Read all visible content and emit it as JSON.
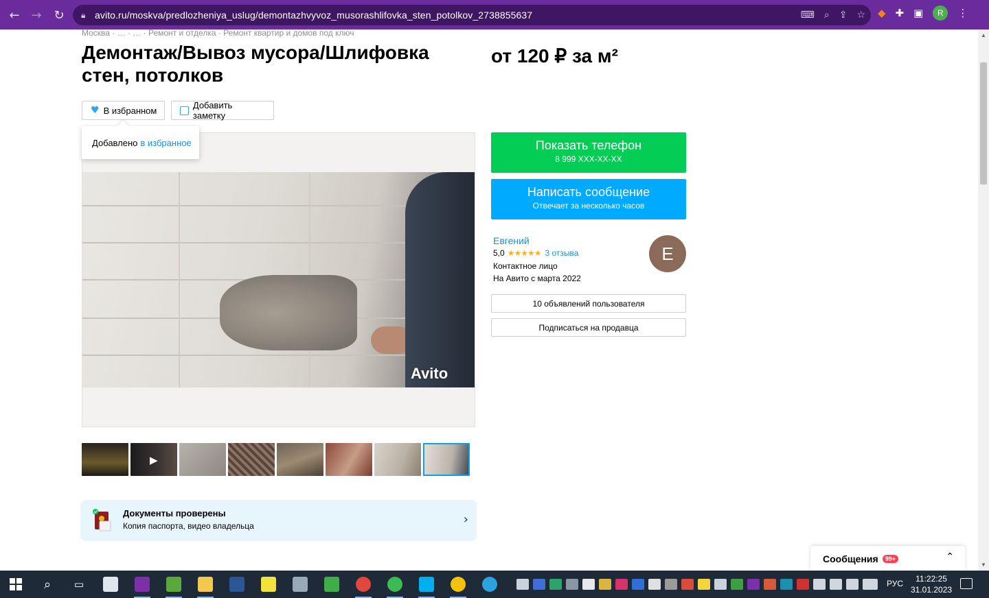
{
  "browser": {
    "url": "avito.ru/moskva/predlozheniya_uslug/demontazhvyvoz_musorashlifovka_sten_potolkov_2738855637",
    "profile_initial": "R"
  },
  "breadcrumbs": "Москва · … · … · Ремонт и отделка · Ремонт квартир и домов под ключ",
  "listing": {
    "title": "Демонтаж/Вывоз мусора/Шлифовка стен, потолков",
    "price": "от 120 ₽ за м²",
    "favorite_label": "В избранном",
    "note_label": "Добавить заметку",
    "tooltip_text": "Добавлено",
    "tooltip_link": "в избранное",
    "watermark": "Avito"
  },
  "contact": {
    "phone_label": "Показать телефон",
    "phone_masked": "8 999 XXX-XX-XX",
    "message_label": "Написать сообщение",
    "message_sub": "Отвечает за несколько часов"
  },
  "seller": {
    "name": "Евгений",
    "rating": "5,0",
    "stars": "★★★★★",
    "reviews": "3 отзыва",
    "role": "Контактное лицо",
    "since": "На Авито с марта 2022",
    "avatar_letter": "Е",
    "listings_button": "10 объявлений пользователя",
    "subscribe_button": "Подписаться на продавца"
  },
  "docs": {
    "title": "Документы проверены",
    "subtitle": "Копия паспорта, видео владельца"
  },
  "messages": {
    "label": "Сообщения",
    "badge": "99+"
  },
  "taskbar": {
    "language": "РУС",
    "time": "11:22:25",
    "date": "31.01.2023"
  },
  "colors": {
    "chrome": "#6a2c9c",
    "green_cta": "#04cd56",
    "blue_cta": "#00aaff",
    "link": "#1a90d9"
  }
}
